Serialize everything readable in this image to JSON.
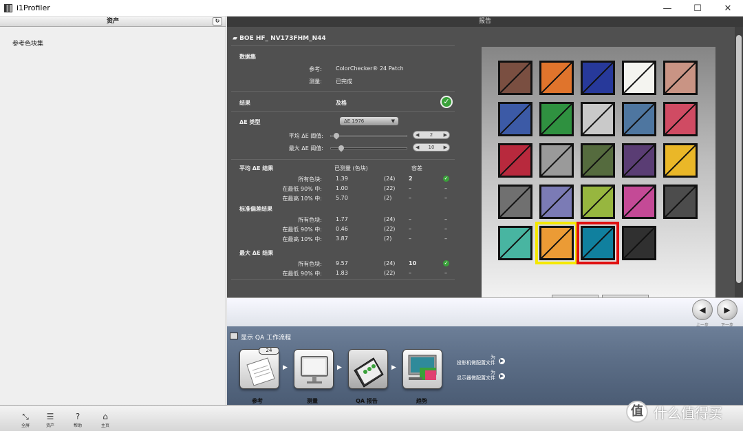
{
  "window": {
    "title": "i1Profiler",
    "minimize": "—",
    "maximize": "☐",
    "close": "✕"
  },
  "assets": {
    "header": "资产",
    "refresh": "↻",
    "item": "参考色块集"
  },
  "report": {
    "header": "报告",
    "device": "BOE HF_        NV173FHM_N44",
    "dataset_label": "数据集",
    "reference_label": "参考:",
    "reference_value": "ColorChecker® 24 Patch",
    "measure_label": "测量:",
    "measure_value": "已完成",
    "result_label": "结果",
    "result_value": "及格",
    "de_type_label": "ΔE 类型",
    "de_type_value": "ΔE 1976",
    "avg_threshold_label": "平均 ΔE 阈值:",
    "avg_threshold_value": "2",
    "max_threshold_label": "最大 ΔE 阈值:",
    "max_threshold_value": "10",
    "measured_header": "已测量 (色块)",
    "pass_header": "容差",
    "sections": [
      {
        "title": "平均 ΔE 结果",
        "rows": [
          {
            "label": "所有色块:",
            "value": "1.39",
            "count": "(24)",
            "tol": "2",
            "check": true
          },
          {
            "label": "在最低 90% 中:",
            "value": "1.00",
            "count": "(22)",
            "tol": "–",
            "check": false
          },
          {
            "label": "在最高 10% 中:",
            "value": "5.70",
            "count": "(2)",
            "tol": "–",
            "check": false
          }
        ]
      },
      {
        "title": "标准偏差结果",
        "rows": [
          {
            "label": "所有色块:",
            "value": "1.77",
            "count": "(24)",
            "tol": "–",
            "check": false
          },
          {
            "label": "在最低 90% 中:",
            "value": "0.46",
            "count": "(22)",
            "tol": "–",
            "check": false
          },
          {
            "label": "在最高 10% 中:",
            "value": "3.87",
            "count": "(2)",
            "tol": "–",
            "check": false
          }
        ]
      },
      {
        "title": "最大 ΔE 结果",
        "rows": [
          {
            "label": "所有色块:",
            "value": "9.57",
            "count": "(24)",
            "tol": "10",
            "check": true
          },
          {
            "label": "在最低 90% 中:",
            "value": "1.83",
            "count": "(22)",
            "tol": "–",
            "check": false
          }
        ]
      }
    ],
    "patches": [
      [
        "#7a4f41",
        "#e0742c",
        "#27399a",
        "#f4f4f0",
        "#c99484"
      ],
      [
        "#3c5aa6",
        "#2f9140",
        "#c9c9c9",
        "#4e76a0",
        "#d04b63"
      ],
      [
        "#b8293d",
        "#9a9a9a",
        "#556b3e",
        "#5a3d74",
        "#eab728"
      ],
      [
        "#707070",
        "#7b7bb5",
        "#97b63f",
        "#c44a96",
        "#4c4c4c"
      ],
      [
        "#48b5a1",
        "#eb9b35",
        "#10809e",
        "#303030"
      ]
    ],
    "highlight_colors": {
      "yellow": "#f5e800",
      "red": "#e01010"
    }
  },
  "nav": {
    "prev_icon": "◀",
    "next_icon": "▶",
    "prev_label": "上一步",
    "next_label": "下一步"
  },
  "workflow": {
    "title": "显示 QA 工作流程",
    "badge": "24",
    "steps": [
      "参考",
      "测量",
      "QA 报告",
      "趋势"
    ],
    "links": [
      {
        "line1": "为",
        "line2": "投影机做配置文件"
      },
      {
        "line1": "为",
        "line2": "显示器做配置文件"
      }
    ]
  },
  "bottombar": {
    "items": [
      {
        "icon": "⤡",
        "label": "全屏"
      },
      {
        "icon": "☰",
        "label": "资产"
      },
      {
        "icon": "?",
        "label": "帮助"
      },
      {
        "icon": "⌂",
        "label": "主页"
      }
    ]
  },
  "watermark": {
    "mark": "值",
    "text": "什么值得买"
  }
}
